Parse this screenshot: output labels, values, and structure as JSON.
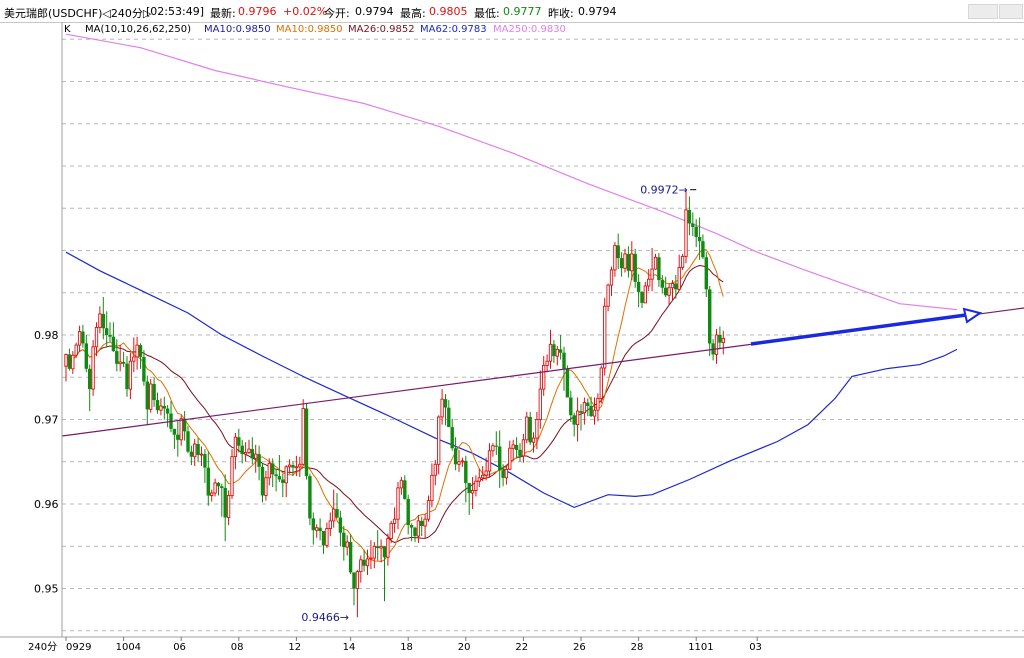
{
  "header": {
    "symbol": "美元瑞郎(USDCHF)◁240分▷",
    "time": "[02:53:49]",
    "latest_label": "最新:",
    "latest_value": "0.9796",
    "change": "+0.02%",
    "open_label": "今开:",
    "open_value": "0.9794",
    "high_label": "最高:",
    "high_value": "0.9805",
    "low_label": "最低:",
    "low_value": "0.9777",
    "prevclose_label": "昨收:",
    "prevclose_value": "0.9794"
  },
  "legend": {
    "k": "K",
    "ma_params": "MA(10,10,26,62,250)",
    "ma10a": "MA10:0.9850",
    "ma10b": "MA10:0.9850",
    "ma26": "MA26:0.9852",
    "ma62": "MA62:0.9783",
    "ma250": "MA250:0.9830"
  },
  "colors": {
    "up": "#e01010",
    "down": "#108a10",
    "ma10a": "#1a1aa0",
    "ma10b": "#e07000",
    "ma26": "#7a1020",
    "ma62": "#1a28d0",
    "ma250": "#e080e8",
    "trendline": "#7a1a6a",
    "arrow": "#1a28e0",
    "grid": "#b8b8b8"
  },
  "chart_data": {
    "type": "candlestick",
    "period": "240分",
    "ylim": [
      0.9415,
      1.0222
    ],
    "y_ticks": [
      "0.98",
      "0.97",
      "0.96",
      "0.95"
    ],
    "x_tick_labels": [
      "0929",
      "1004",
      "06",
      "08",
      "12",
      "14",
      "18",
      "20",
      "22",
      "26",
      "28",
      "1101",
      "03"
    ],
    "annotations": {
      "high": "0.9972",
      "low": "0.9466"
    },
    "candles": [
      [
        0.9763,
        0.9777,
        0.9745,
        0.9778
      ],
      [
        0.9777,
        0.976,
        0.9758,
        0.9784
      ],
      [
        0.976,
        0.9776,
        0.9754,
        0.9781
      ],
      [
        0.9776,
        0.9788,
        0.9773,
        0.9791
      ],
      [
        0.9788,
        0.9804,
        0.978,
        0.9811
      ],
      [
        0.9804,
        0.979,
        0.9785,
        0.9812
      ],
      [
        0.979,
        0.976,
        0.9756,
        0.98
      ],
      [
        0.976,
        0.9736,
        0.971,
        0.9765
      ],
      [
        0.9736,
        0.9786,
        0.9728,
        0.9794
      ],
      [
        0.9786,
        0.9809,
        0.9775,
        0.9815
      ],
      [
        0.9809,
        0.9825,
        0.9802,
        0.9834
      ],
      [
        0.9825,
        0.9808,
        0.9795,
        0.9845
      ],
      [
        0.9808,
        0.98,
        0.9785,
        0.9828
      ],
      [
        0.98,
        0.9798,
        0.9792,
        0.9815
      ],
      [
        0.9798,
        0.9781,
        0.978,
        0.9815
      ],
      [
        0.9781,
        0.9766,
        0.9757,
        0.9795
      ],
      [
        0.9766,
        0.9768,
        0.9757,
        0.9788
      ],
      [
        0.9768,
        0.9766,
        0.9762,
        0.978
      ],
      [
        0.9766,
        0.9736,
        0.9727,
        0.9775
      ],
      [
        0.9736,
        0.9769,
        0.9724,
        0.9779
      ],
      [
        0.9769,
        0.9774,
        0.9756,
        0.9797
      ],
      [
        0.9774,
        0.9788,
        0.9759,
        0.9798
      ],
      [
        0.9788,
        0.9774,
        0.976,
        0.979
      ],
      [
        0.9774,
        0.9745,
        0.974,
        0.9782
      ],
      [
        0.9745,
        0.9712,
        0.9693,
        0.9752
      ],
      [
        0.9712,
        0.9742,
        0.9708,
        0.9748
      ],
      [
        0.9742,
        0.9723,
        0.9715,
        0.975
      ],
      [
        0.9723,
        0.9711,
        0.9707,
        0.9732
      ],
      [
        0.9711,
        0.9716,
        0.9705,
        0.9725
      ],
      [
        0.9716,
        0.9713,
        0.97,
        0.9727
      ],
      [
        0.9713,
        0.9707,
        0.9691,
        0.9717
      ],
      [
        0.9707,
        0.9689,
        0.9685,
        0.9722
      ],
      [
        0.9689,
        0.9682,
        0.9665,
        0.9689
      ],
      [
        0.9682,
        0.9676,
        0.9656,
        0.9698
      ],
      [
        0.9676,
        0.9701,
        0.9669,
        0.9705
      ],
      [
        0.9701,
        0.9686,
        0.9675,
        0.971
      ],
      [
        0.9686,
        0.9662,
        0.966,
        0.9692
      ],
      [
        0.9662,
        0.9656,
        0.9646,
        0.9669
      ],
      [
        0.9656,
        0.9671,
        0.9645,
        0.9677
      ],
      [
        0.9671,
        0.9658,
        0.965,
        0.9678
      ],
      [
        0.9658,
        0.9659,
        0.9645,
        0.9668
      ],
      [
        0.9659,
        0.9643,
        0.9625,
        0.9665
      ],
      [
        0.9643,
        0.961,
        0.9598,
        0.9662
      ],
      [
        0.961,
        0.9613,
        0.9603,
        0.9617
      ],
      [
        0.9613,
        0.9625,
        0.9609,
        0.963
      ],
      [
        0.9625,
        0.9621,
        0.961,
        0.9626
      ],
      [
        0.9621,
        0.9619,
        0.9585,
        0.9624
      ],
      [
        0.9619,
        0.9584,
        0.9556,
        0.9635
      ],
      [
        0.9584,
        0.961,
        0.9575,
        0.9616
      ],
      [
        0.961,
        0.9656,
        0.9606,
        0.9665
      ],
      [
        0.9656,
        0.9679,
        0.9641,
        0.9684
      ],
      [
        0.9679,
        0.9669,
        0.9661,
        0.9689
      ],
      [
        0.9669,
        0.9659,
        0.9648,
        0.9676
      ],
      [
        0.9659,
        0.9661,
        0.965,
        0.9673
      ],
      [
        0.9661,
        0.9665,
        0.9659,
        0.9676
      ],
      [
        0.9665,
        0.9654,
        0.9647,
        0.9679
      ],
      [
        0.9654,
        0.9659,
        0.9637,
        0.967
      ],
      [
        0.9659,
        0.9644,
        0.9628,
        0.9669
      ],
      [
        0.9644,
        0.961,
        0.9602,
        0.9648
      ],
      [
        0.961,
        0.9631,
        0.9604,
        0.9639
      ],
      [
        0.9631,
        0.9648,
        0.9622,
        0.9654
      ],
      [
        0.9648,
        0.9635,
        0.962,
        0.9654
      ],
      [
        0.9635,
        0.9633,
        0.9615,
        0.9642
      ],
      [
        0.9633,
        0.9629,
        0.9626,
        0.9658
      ],
      [
        0.9629,
        0.9625,
        0.9608,
        0.9636
      ],
      [
        0.9625,
        0.9644,
        0.9608,
        0.9646
      ],
      [
        0.9644,
        0.9646,
        0.9636,
        0.9653
      ],
      [
        0.9646,
        0.9643,
        0.9633,
        0.9651
      ],
      [
        0.9643,
        0.9644,
        0.9633,
        0.9657
      ],
      [
        0.9644,
        0.9647,
        0.9632,
        0.9656
      ],
      [
        0.9647,
        0.9713,
        0.9646,
        0.9724
      ],
      [
        0.9713,
        0.9633,
        0.9629,
        0.9719
      ],
      [
        0.9633,
        0.9583,
        0.9575,
        0.9636
      ],
      [
        0.9583,
        0.9569,
        0.9552,
        0.959
      ],
      [
        0.9569,
        0.9572,
        0.956,
        0.9576
      ],
      [
        0.9572,
        0.9568,
        0.9557,
        0.9583
      ],
      [
        0.9568,
        0.9551,
        0.9541,
        0.9568
      ],
      [
        0.9551,
        0.9571,
        0.9548,
        0.9578
      ],
      [
        0.9571,
        0.958,
        0.9562,
        0.959
      ],
      [
        0.958,
        0.9594,
        0.9572,
        0.9617
      ],
      [
        0.9594,
        0.9584,
        0.9583,
        0.9613
      ],
      [
        0.9584,
        0.9566,
        0.955,
        0.9592
      ],
      [
        0.9566,
        0.9549,
        0.9533,
        0.9574
      ],
      [
        0.9549,
        0.9555,
        0.9539,
        0.9563
      ],
      [
        0.9555,
        0.9519,
        0.9517,
        0.9564
      ],
      [
        0.9519,
        0.95,
        0.948,
        0.9519
      ],
      [
        0.95,
        0.952,
        0.9466,
        0.9522
      ],
      [
        0.952,
        0.9534,
        0.9507,
        0.9539
      ],
      [
        0.9534,
        0.9527,
        0.952,
        0.9546
      ],
      [
        0.9527,
        0.9535,
        0.9516,
        0.9546
      ],
      [
        0.9535,
        0.9536,
        0.9523,
        0.9557
      ],
      [
        0.9536,
        0.955,
        0.9524,
        0.9555
      ],
      [
        0.955,
        0.9548,
        0.9533,
        0.9569
      ],
      [
        0.9548,
        0.955,
        0.9531,
        0.9558
      ],
      [
        0.955,
        0.9537,
        0.9485,
        0.955
      ],
      [
        0.9537,
        0.9559,
        0.9527,
        0.9565
      ],
      [
        0.9559,
        0.9577,
        0.9554,
        0.958
      ],
      [
        0.9577,
        0.9582,
        0.9566,
        0.9596
      ],
      [
        0.9582,
        0.9619,
        0.957,
        0.9626
      ],
      [
        0.9619,
        0.9628,
        0.9611,
        0.9632
      ],
      [
        0.9628,
        0.9606,
        0.9605,
        0.9634
      ],
      [
        0.9606,
        0.9575,
        0.9564,
        0.9611
      ],
      [
        0.9575,
        0.9572,
        0.9556,
        0.9577
      ],
      [
        0.9572,
        0.9562,
        0.9555,
        0.9573
      ],
      [
        0.9562,
        0.958,
        0.9554,
        0.9587
      ],
      [
        0.958,
        0.9574,
        0.9562,
        0.9585
      ],
      [
        0.9574,
        0.9582,
        0.956,
        0.9588
      ],
      [
        0.9582,
        0.9604,
        0.9579,
        0.961
      ],
      [
        0.9604,
        0.9634,
        0.9596,
        0.9648
      ],
      [
        0.9634,
        0.9647,
        0.9622,
        0.9652
      ],
      [
        0.9647,
        0.9703,
        0.9635,
        0.9705
      ],
      [
        0.9703,
        0.9724,
        0.9694,
        0.9736
      ],
      [
        0.9724,
        0.9714,
        0.9693,
        0.973
      ],
      [
        0.9714,
        0.9691,
        0.9691,
        0.9723
      ],
      [
        0.9691,
        0.9666,
        0.9663,
        0.9701
      ],
      [
        0.9666,
        0.9647,
        0.964,
        0.9679
      ],
      [
        0.9647,
        0.965,
        0.9638,
        0.9664
      ],
      [
        0.965,
        0.9651,
        0.9644,
        0.9655
      ],
      [
        0.9651,
        0.9625,
        0.9602,
        0.9657
      ],
      [
        0.9625,
        0.9613,
        0.9587,
        0.9624
      ],
      [
        0.9613,
        0.9616,
        0.9594,
        0.9632
      ],
      [
        0.9616,
        0.9627,
        0.9609,
        0.9634
      ],
      [
        0.9627,
        0.9631,
        0.962,
        0.9642
      ],
      [
        0.9631,
        0.9634,
        0.9627,
        0.9645
      ],
      [
        0.9634,
        0.9639,
        0.9628,
        0.9655
      ],
      [
        0.9639,
        0.9663,
        0.9631,
        0.9672
      ],
      [
        0.9663,
        0.9669,
        0.9656,
        0.9672
      ],
      [
        0.9669,
        0.9668,
        0.9658,
        0.9686
      ],
      [
        0.9668,
        0.964,
        0.9619,
        0.9687
      ],
      [
        0.964,
        0.9631,
        0.9621,
        0.9647
      ],
      [
        0.9631,
        0.9641,
        0.9623,
        0.9646
      ],
      [
        0.9641,
        0.9666,
        0.964,
        0.9675
      ],
      [
        0.9666,
        0.967,
        0.9651,
        0.9676
      ],
      [
        0.967,
        0.9664,
        0.9654,
        0.9679
      ],
      [
        0.9664,
        0.9657,
        0.965,
        0.9672
      ],
      [
        0.9657,
        0.9676,
        0.9649,
        0.9683
      ],
      [
        0.9676,
        0.9703,
        0.9672,
        0.9709
      ],
      [
        0.9703,
        0.9673,
        0.967,
        0.9709
      ],
      [
        0.9673,
        0.9678,
        0.9661,
        0.9685
      ],
      [
        0.9678,
        0.97,
        0.9665,
        0.9709
      ],
      [
        0.97,
        0.9736,
        0.9689,
        0.9758
      ],
      [
        0.9736,
        0.9764,
        0.9728,
        0.9775
      ],
      [
        0.9764,
        0.9769,
        0.9756,
        0.9777
      ],
      [
        0.9769,
        0.9789,
        0.976,
        0.9806
      ],
      [
        0.9789,
        0.9775,
        0.9767,
        0.9794
      ],
      [
        0.9775,
        0.9783,
        0.9764,
        0.9787
      ],
      [
        0.9783,
        0.9779,
        0.9771,
        0.98
      ],
      [
        0.9779,
        0.976,
        0.9734,
        0.9786
      ],
      [
        0.976,
        0.9726,
        0.9726,
        0.9764
      ],
      [
        0.9726,
        0.9705,
        0.9697,
        0.9734
      ],
      [
        0.9705,
        0.9694,
        0.968,
        0.9708
      ],
      [
        0.9694,
        0.971,
        0.9674,
        0.9726
      ],
      [
        0.971,
        0.9708,
        0.9687,
        0.9718
      ],
      [
        0.9708,
        0.972,
        0.9694,
        0.9726
      ],
      [
        0.972,
        0.9716,
        0.9704,
        0.9725
      ],
      [
        0.9716,
        0.9704,
        0.9703,
        0.9727
      ],
      [
        0.9704,
        0.9711,
        0.9694,
        0.9726
      ],
      [
        0.9711,
        0.9725,
        0.9698,
        0.9731
      ],
      [
        0.9725,
        0.9761,
        0.9719,
        0.9764
      ],
      [
        0.9761,
        0.9834,
        0.9752,
        0.9844
      ],
      [
        0.9834,
        0.9859,
        0.9828,
        0.9861
      ],
      [
        0.9859,
        0.9877,
        0.9846,
        0.9881
      ],
      [
        0.9877,
        0.9906,
        0.9869,
        0.991
      ],
      [
        0.9906,
        0.9891,
        0.9878,
        0.992
      ],
      [
        0.9891,
        0.9879,
        0.9869,
        0.9898
      ],
      [
        0.9879,
        0.9896,
        0.9874,
        0.9902
      ],
      [
        0.9896,
        0.9876,
        0.9868,
        0.9905
      ],
      [
        0.9876,
        0.9896,
        0.9865,
        0.9911
      ],
      [
        0.9896,
        0.9863,
        0.9856,
        0.9902
      ],
      [
        0.9863,
        0.9851,
        0.9833,
        0.9872
      ],
      [
        0.9851,
        0.9838,
        0.9832,
        0.9852
      ],
      [
        0.9838,
        0.9858,
        0.9838,
        0.9863
      ],
      [
        0.9858,
        0.9866,
        0.9852,
        0.9878
      ],
      [
        0.9866,
        0.9878,
        0.9852,
        0.9903
      ],
      [
        0.9878,
        0.9892,
        0.9877,
        0.9896
      ],
      [
        0.9892,
        0.9865,
        0.9857,
        0.9897
      ],
      [
        0.9865,
        0.9856,
        0.9849,
        0.9871
      ],
      [
        0.9856,
        0.9847,
        0.9845,
        0.9869
      ],
      [
        0.9847,
        0.9856,
        0.9836,
        0.9861
      ],
      [
        0.9856,
        0.9861,
        0.9841,
        0.9865
      ],
      [
        0.9861,
        0.9854,
        0.9843,
        0.9871
      ],
      [
        0.9854,
        0.988,
        0.9852,
        0.9895
      ],
      [
        0.988,
        0.9893,
        0.9877,
        0.9896
      ],
      [
        0.9893,
        0.9948,
        0.9885,
        0.9972
      ],
      [
        0.9948,
        0.9932,
        0.9918,
        0.9964
      ],
      [
        0.9932,
        0.9928,
        0.9917,
        0.9945
      ],
      [
        0.9928,
        0.9916,
        0.9904,
        0.9937
      ],
      [
        0.9916,
        0.9911,
        0.9889,
        0.9939
      ],
      [
        0.9911,
        0.9892,
        0.989,
        0.9919
      ],
      [
        0.9892,
        0.9854,
        0.9845,
        0.9898
      ],
      [
        0.9854,
        0.979,
        0.9775,
        0.9858
      ],
      [
        0.979,
        0.9777,
        0.977,
        0.9795
      ],
      [
        0.9777,
        0.98,
        0.9766,
        0.9807
      ],
      [
        0.98,
        0.9791,
        0.9783,
        0.981
      ],
      [
        0.9791,
        0.9796,
        0.9777,
        0.9805
      ]
    ],
    "ma62_points": [
      [
        0,
        0.9898
      ],
      [
        10,
        0.9876
      ],
      [
        22,
        0.9853
      ],
      [
        36,
        0.9826
      ],
      [
        46,
        0.98
      ],
      [
        58,
        0.9775
      ],
      [
        71,
        0.9749
      ],
      [
        84,
        0.9725
      ],
      [
        96,
        0.9703
      ],
      [
        109,
        0.9678
      ],
      [
        120,
        0.966
      ],
      [
        131,
        0.9637
      ],
      [
        141,
        0.9613
      ],
      [
        150,
        0.9596
      ],
      [
        160,
        0.9611
      ],
      [
        168,
        0.9609
      ],
      [
        173,
        0.9611
      ],
      [
        184,
        0.9629
      ],
      [
        196,
        0.9651
      ],
      [
        210,
        0.9674
      ],
      [
        219,
        0.9694
      ],
      [
        227,
        0.9725
      ],
      [
        232,
        0.9751
      ],
      [
        242,
        0.976
      ],
      [
        252,
        0.9765
      ],
      [
        259,
        0.9775
      ],
      [
        263,
        0.9783
      ]
    ],
    "ma250_points": [
      [
        0,
        1.0156
      ],
      [
        22,
        1.014
      ],
      [
        44,
        1.0113
      ],
      [
        66,
        1.0093
      ],
      [
        88,
        1.0074
      ],
      [
        110,
        1.0047
      ],
      [
        132,
        1.0015
      ],
      [
        154,
        0.9979
      ],
      [
        176,
        0.9946
      ],
      [
        192,
        0.992
      ],
      [
        204,
        0.9898
      ],
      [
        218,
        0.9877
      ],
      [
        232,
        0.9857
      ],
      [
        246,
        0.9837
      ],
      [
        263,
        0.983
      ]
    ]
  }
}
